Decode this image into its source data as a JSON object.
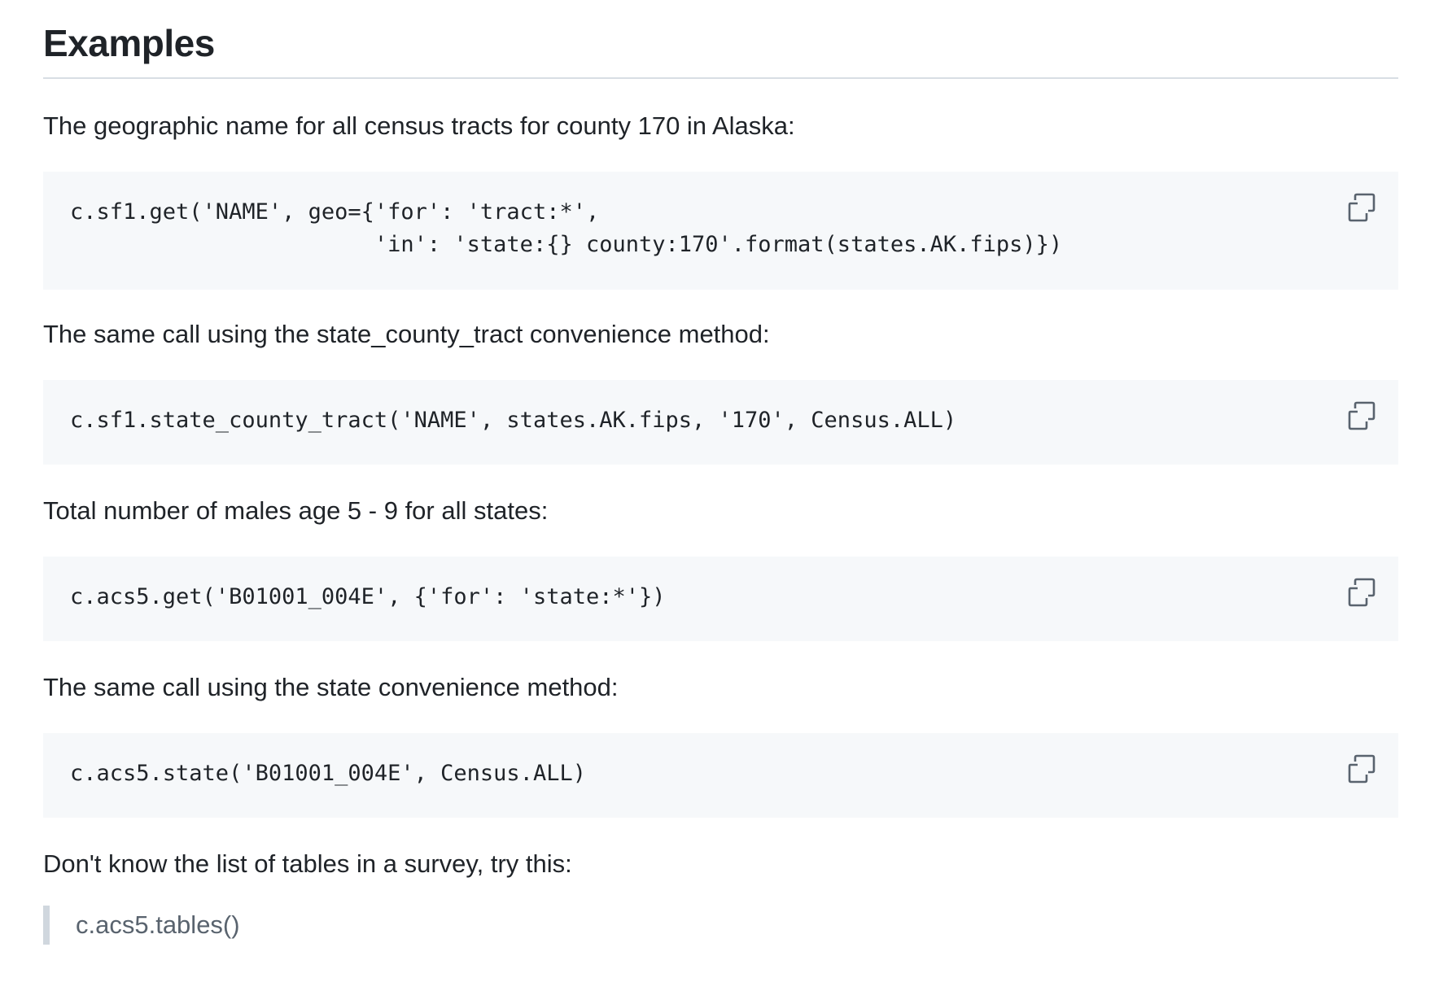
{
  "heading": "Examples",
  "sections": [
    {
      "text": "The geographic name for all census tracts for county 170 in Alaska:",
      "code": "c.sf1.get('NAME', geo={'for': 'tract:*',\n                       'in': 'state:{} county:170'.format(states.AK.fips)})"
    },
    {
      "text": "The same call using the state_county_tract convenience method:",
      "code": "c.sf1.state_county_tract('NAME', states.AK.fips, '170', Census.ALL)"
    },
    {
      "text": "Total number of males age 5 - 9 for all states:",
      "code": "c.acs5.get('B01001_004E', {'for': 'state:*'})"
    },
    {
      "text": "The same call using the state convenience method:",
      "code": "c.acs5.state('B01001_004E', Census.ALL)"
    },
    {
      "text": "Don't know the list of tables in a survey, try this:"
    }
  ],
  "blockquote": "c.acs5.tables()",
  "icons": {
    "copy": "copy-icon"
  }
}
